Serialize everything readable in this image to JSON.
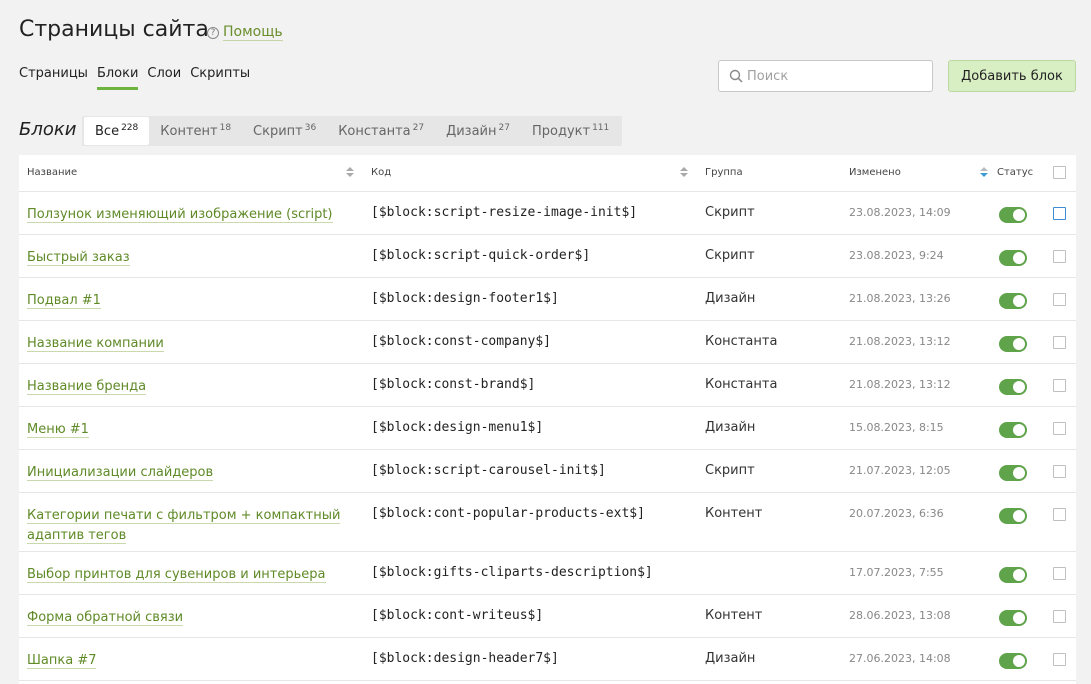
{
  "header": {
    "title": "Страницы сайта",
    "help_icon": "question-circle-icon",
    "help_label": "Помощь"
  },
  "subnav": [
    {
      "label": "Страницы",
      "active": false
    },
    {
      "label": "Блоки",
      "active": true
    },
    {
      "label": "Слои",
      "active": false
    },
    {
      "label": "Скрипты",
      "active": false
    }
  ],
  "search": {
    "placeholder": "Поиск",
    "icon": "search-icon"
  },
  "toolbar": {
    "add_label": "Добавить блок"
  },
  "section": {
    "title": "Блоки"
  },
  "filters": [
    {
      "label": "Все",
      "count": "228",
      "active": true
    },
    {
      "label": "Контент",
      "count": "18",
      "active": false
    },
    {
      "label": "Скрипт",
      "count": "36",
      "active": false
    },
    {
      "label": "Константа",
      "count": "27",
      "active": false
    },
    {
      "label": "Дизайн",
      "count": "27",
      "active": false
    },
    {
      "label": "Продукт",
      "count": "111",
      "active": false
    }
  ],
  "table": {
    "columns": {
      "name": "Название",
      "code": "Код",
      "group": "Группа",
      "modified": "Изменено",
      "status": "Статус"
    },
    "rows": [
      {
        "name": "Ползунок изменяющий изображение (script)",
        "code": "[$block:script-resize-image-init$]",
        "group": "Скрипт",
        "modified": "23.08.2023, 14:09",
        "status": true
      },
      {
        "name": "Быстрый заказ",
        "code": "[$block:script-quick-order$]",
        "group": "Скрипт",
        "modified": "23.08.2023, 9:24",
        "status": true
      },
      {
        "name": "Подвал #1",
        "code": "[$block:design-footer1$]",
        "group": "Дизайн",
        "modified": "21.08.2023, 13:26",
        "status": true
      },
      {
        "name": "Название компании",
        "code": "[$block:const-company$]",
        "group": "Константа",
        "modified": "21.08.2023, 13:12",
        "status": true
      },
      {
        "name": "Название бренда",
        "code": "[$block:const-brand$]",
        "group": "Константа",
        "modified": "21.08.2023, 13:12",
        "status": true
      },
      {
        "name": "Меню #1",
        "code": "[$block:design-menu1$]",
        "group": "Дизайн",
        "modified": "15.08.2023, 8:15",
        "status": true
      },
      {
        "name": "Инициализации слайдеров",
        "code": "[$block:script-carousel-init$]",
        "group": "Скрипт",
        "modified": "21.07.2023, 12:05",
        "status": true
      },
      {
        "name_line1": "Категории печати с фильтром + компактный",
        "name_line2": "адаптив тегов",
        "code": "[$block:cont-popular-products-ext$]",
        "group": "Контент",
        "modified": "20.07.2023, 6:36",
        "status": true
      },
      {
        "name": "Выбор принтов для сувениров и интерьера",
        "code": "[$block:gifts-cliparts-description$]",
        "group": "",
        "modified": "17.07.2023, 7:55",
        "status": true
      },
      {
        "name": "Форма обратной связи",
        "code": "[$block:cont-writeus$]",
        "group": "Контент",
        "modified": "28.06.2023, 13:08",
        "status": true
      },
      {
        "name": "Шапка #7",
        "code": "[$block:design-header7$]",
        "group": "Дизайн",
        "modified": "27.06.2023, 14:08",
        "status": true
      }
    ]
  }
}
